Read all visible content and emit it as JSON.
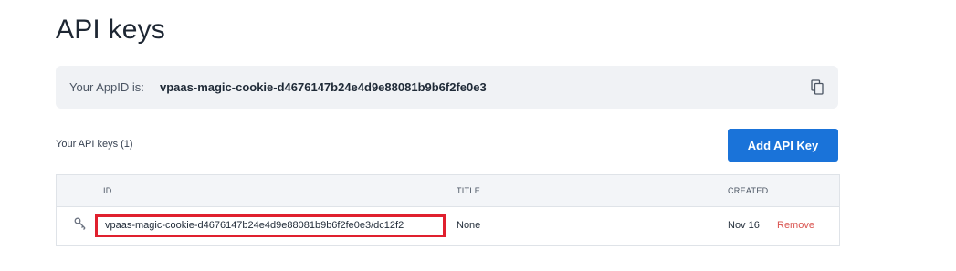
{
  "page": {
    "title": "API keys"
  },
  "appid": {
    "label": "Your AppID is:",
    "value": "vpaas-magic-cookie-d4676147b24e4d9e88081b9b6f2fe0e3",
    "copy_icon": "copy-icon"
  },
  "keys": {
    "count_label": "Your API keys (1)",
    "add_button_label": "Add API Key",
    "columns": [
      "ID",
      "TITLE",
      "CREATED"
    ],
    "rows": [
      {
        "icon": "key-icon",
        "id": "vpaas-magic-cookie-d4676147b24e4d9e88081b9b6f2fe0e3/dc12f2",
        "title": "None",
        "created": "Nov 16",
        "action": "Remove"
      }
    ]
  },
  "colors": {
    "accent": "#1a73d9",
    "remove": "#d9534f",
    "highlight_border": "#e0202e",
    "appid_bg": "#f0f2f5"
  }
}
